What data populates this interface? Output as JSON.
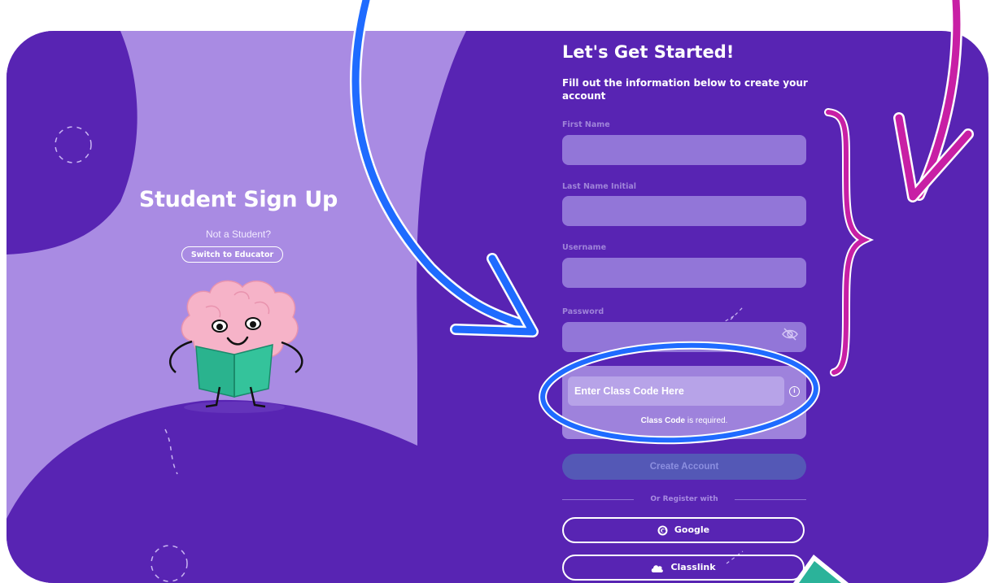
{
  "left_panel": {
    "title": "Student Sign Up",
    "subtitle": "Not a Student?",
    "switch_button": "Switch to Educator"
  },
  "form": {
    "heading": "Let's Get Started!",
    "subheading": "Fill out the information below to create your account",
    "fields": [
      {
        "label": "First Name",
        "value": ""
      },
      {
        "label": "Last Name Initial",
        "value": ""
      },
      {
        "label": "Username",
        "value": ""
      },
      {
        "label": "Password",
        "value": ""
      }
    ],
    "class_code": {
      "placeholder": "Enter Class Code Here",
      "error_bold": "Class Code",
      "error_rest": " is required."
    },
    "create_button": "Create Account",
    "divider_text": "Or Register with",
    "google_button": "Google",
    "classlink_button": "Classlink"
  },
  "colors": {
    "background_dark": "#5824b3",
    "panel_light": "#a98be3",
    "annotation_blue": "#1f6bff",
    "annotation_magenta": "#c81fa5",
    "annotation_teal": "#2bb39a"
  },
  "icons": [
    "google-icon",
    "classlink-icon",
    "eye-hidden-icon",
    "info-icon",
    "brain-mascot"
  ]
}
